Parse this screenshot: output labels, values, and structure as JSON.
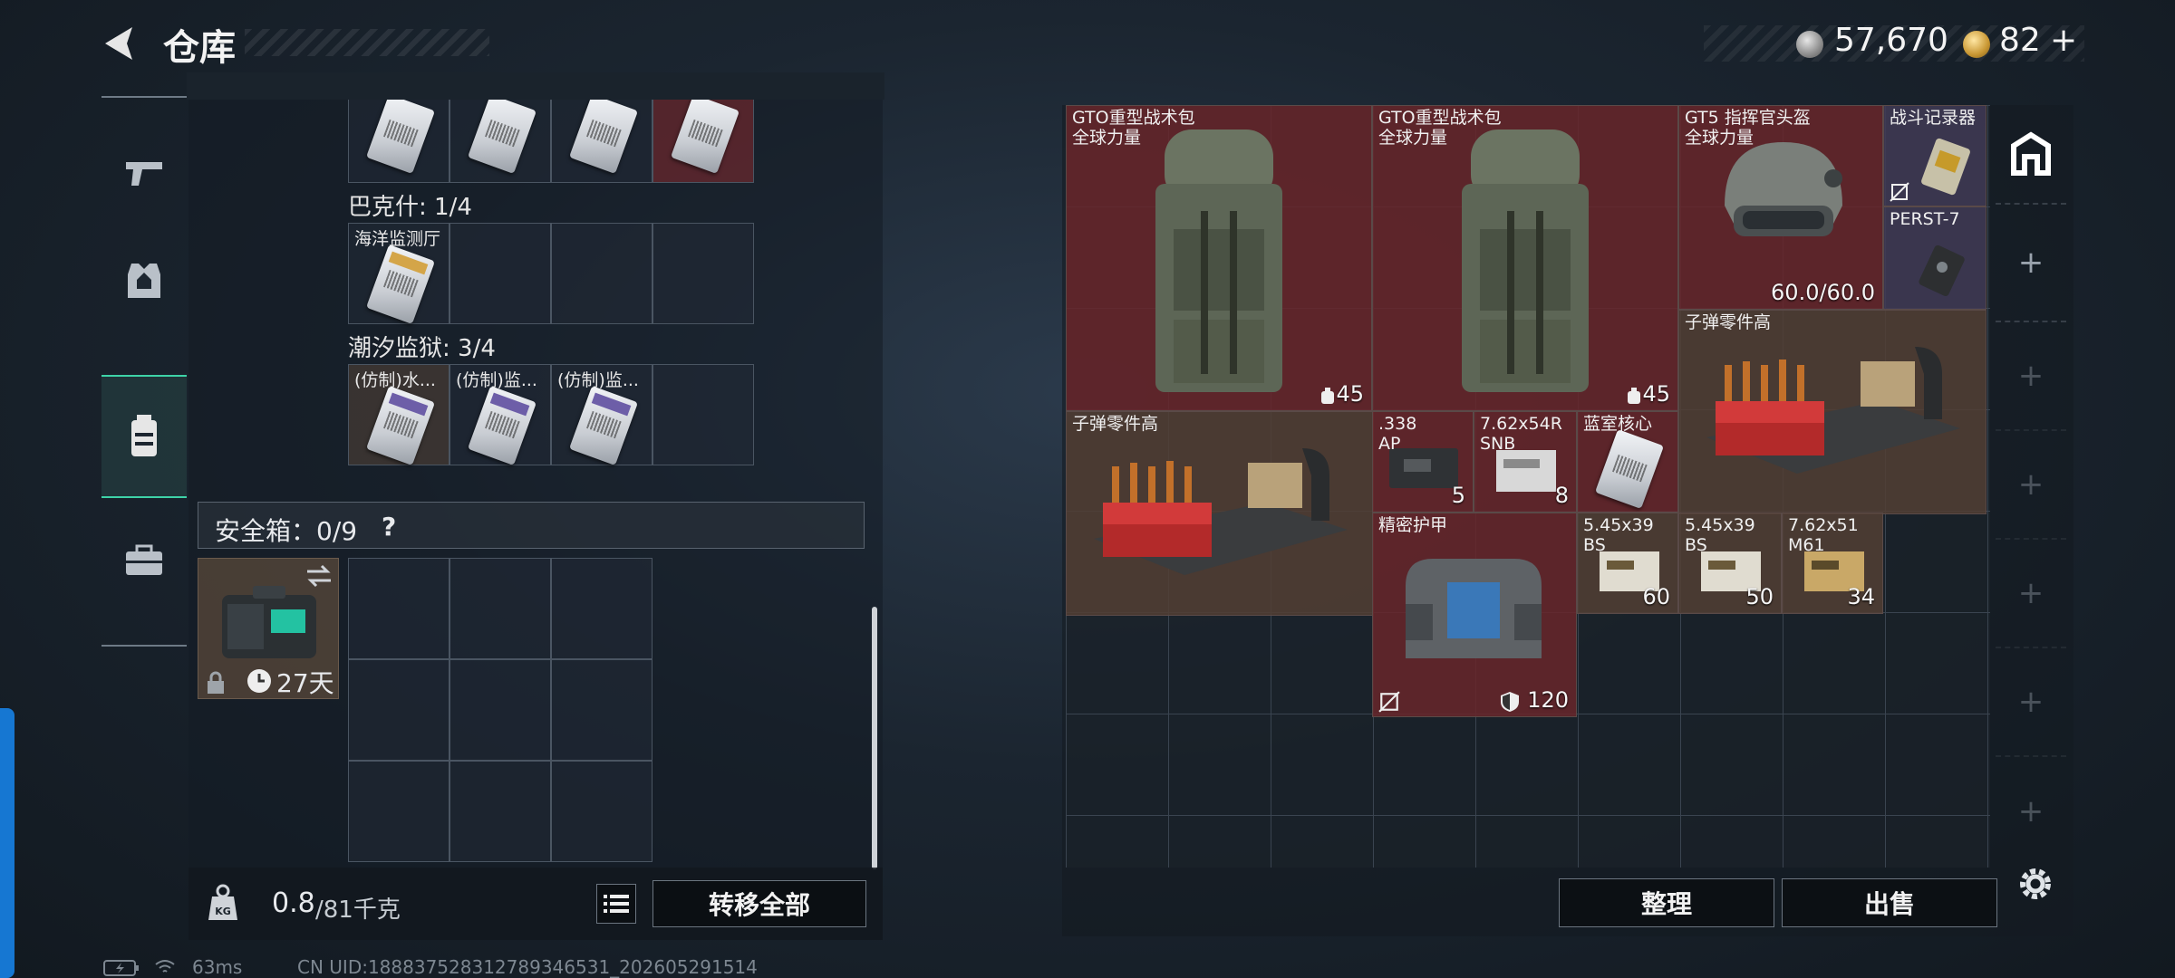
{
  "header": {
    "title": "仓库",
    "silver_value": "57,670",
    "gold_value": "82",
    "gold_plus": "+"
  },
  "nav": {
    "items": [
      "pistol-icon",
      "armor-icon",
      "backpack-icon",
      "toolbox-icon"
    ],
    "active_index": 2
  },
  "left": {
    "sections": [
      {
        "label": "巴克什: 1/4"
      },
      {
        "label": "潮汐监狱: 3/4"
      }
    ],
    "seaside_cell_text": "海洋监测厅",
    "prison_items": [
      "(仿制)水...",
      "(仿制)监...",
      "(仿制)监..."
    ],
    "safe_label": "安全箱：0/9",
    "safe_help": "?",
    "safe_days": "27天",
    "weight_value": "0.8",
    "weight_max": "/81千克",
    "transfer_all": "转移全部"
  },
  "right": {
    "items": [
      {
        "name": "GTO重型战术包",
        "sub": "全球力量",
        "count": "45"
      },
      {
        "name": "GTO重型战术包",
        "sub": "全球力量",
        "count": "45"
      },
      {
        "name": "GT5 指挥官头盔",
        "sub": "全球力量",
        "count": "60.0/60.0"
      },
      {
        "name": "战斗记录器"
      },
      {
        "name": "PERST-7"
      },
      {
        "name": "子弹零件高"
      },
      {
        "name": "子弹零件高"
      },
      {
        "name": ".338",
        "sub": "AP",
        "count": "5"
      },
      {
        "name": "7.62x54R",
        "sub": "SNB",
        "count": "8"
      },
      {
        "name": "蓝室核心"
      },
      {
        "name": "精密护甲",
        "count": "120"
      },
      {
        "name": "5.45x39",
        "sub": "BS",
        "count": "60"
      },
      {
        "name": "5.45x39",
        "sub": "BS",
        "count": "50"
      },
      {
        "name": "7.62x51",
        "sub": "M61",
        "count": "34"
      }
    ],
    "organize": "整理",
    "sell": "出售"
  },
  "footer": {
    "ping": "63ms",
    "uid": "CN UID:1888375283127893465​31_202605291514"
  },
  "colors": {
    "accent": "#3ed3a8",
    "red_cell": "#692a2e",
    "brown_cell": "#523e34",
    "blue_edge": "#1677d2"
  }
}
